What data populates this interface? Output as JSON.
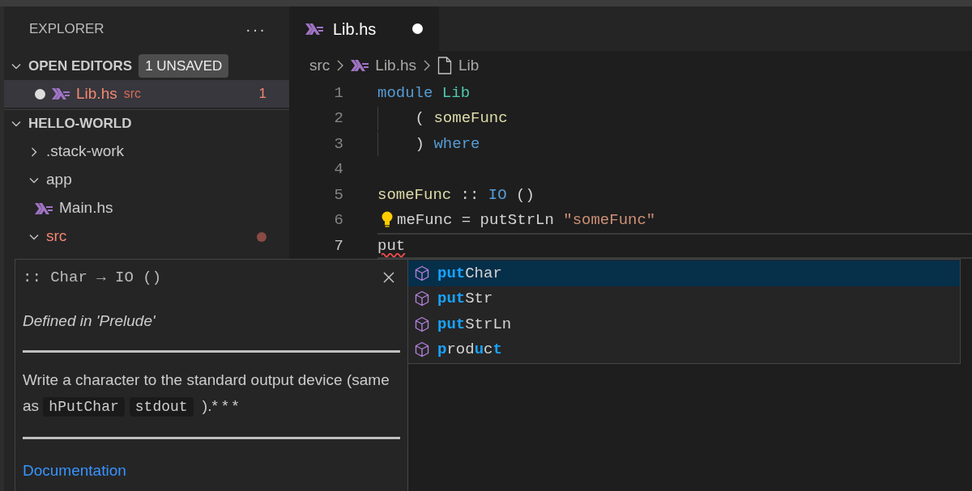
{
  "sidebar": {
    "title": "EXPLORER",
    "more": "···",
    "open_editors": {
      "label": "OPEN EDITORS",
      "expanded": true,
      "badge": "1 UNSAVED",
      "items": [
        {
          "name": "Lib.hs",
          "folder": "src",
          "problems": "1",
          "unsaved": true,
          "selected": true
        }
      ]
    },
    "project": {
      "label": "HELLO-WORLD",
      "expanded": true,
      "children": [
        {
          "name": ".stack-work",
          "kind": "folder",
          "expanded": false,
          "error": false
        },
        {
          "name": "app",
          "kind": "folder",
          "expanded": true,
          "error": false,
          "children": [
            {
              "name": "Main.hs",
              "kind": "haskell",
              "error": false
            }
          ]
        },
        {
          "name": "src",
          "kind": "folder",
          "expanded": true,
          "error": true
        }
      ]
    }
  },
  "tabs": [
    {
      "label": "Lib.hs",
      "selected": true,
      "unsaved": true
    }
  ],
  "breadcrumb": [
    "src",
    "Lib.hs",
    "Lib"
  ],
  "editor": {
    "lines": [
      {
        "number": "1",
        "current": false,
        "guide": false,
        "tokens": [
          {
            "text": "module",
            "kind": "keyword"
          },
          {
            "text": " Lib",
            "kind": "module"
          }
        ]
      },
      {
        "number": "2",
        "current": false,
        "guide": true,
        "tokens": [
          {
            "text": "    ( ",
            "kind": "plain"
          },
          {
            "text": "someFunc",
            "kind": "function"
          }
        ]
      },
      {
        "number": "3",
        "current": false,
        "guide": true,
        "tokens": [
          {
            "text": "    ) ",
            "kind": "plain"
          },
          {
            "text": "where",
            "kind": "keyword"
          }
        ]
      },
      {
        "number": "4",
        "current": false,
        "guide": false
      },
      {
        "number": "5",
        "current": false,
        "guide": false,
        "tokens": [
          {
            "text": "someFunc",
            "kind": "function"
          },
          {
            "text": " :: ",
            "kind": "plain"
          },
          {
            "text": "IO",
            "kind": "keyword"
          },
          {
            "text": " ()",
            "kind": "plain"
          }
        ]
      },
      {
        "number": "6",
        "current": false,
        "guide": false,
        "lightbulb": true,
        "tokens": [
          {
            "text": "meFunc = putStrLn ",
            "kind": "plain"
          },
          {
            "text": "\"someFunc\"",
            "kind": "string"
          }
        ]
      },
      {
        "number": "7",
        "current": true,
        "guide": false,
        "tokens": [
          {
            "text": "put",
            "kind": "error"
          }
        ]
      }
    ]
  },
  "hover": {
    "signature": ":: Char → IO ()",
    "defined": "Defined in 'Prelude'",
    "description": [
      {
        "text": "Write a character to the standard output device (same as ",
        "kind": "text"
      },
      {
        "text": "hPutChar",
        "kind": "code"
      },
      {
        "text": "stdout",
        "kind": "code"
      },
      {
        "text": " ).* * *",
        "kind": "text"
      }
    ],
    "link": "Documentation"
  },
  "suggestions": [
    {
      "selected": true,
      "segments": [
        {
          "text": "put",
          "matched": true
        },
        {
          "text": "Char",
          "matched": false
        }
      ]
    },
    {
      "selected": false,
      "segments": [
        {
          "text": "put",
          "matched": true
        },
        {
          "text": "Str",
          "matched": false
        }
      ]
    },
    {
      "selected": false,
      "segments": [
        {
          "text": "put",
          "matched": true
        },
        {
          "text": "StrLn",
          "matched": false
        }
      ]
    },
    {
      "selected": false,
      "segments": [
        {
          "text": "p",
          "matched": true
        },
        {
          "text": "rod",
          "matched": false
        },
        {
          "text": "u",
          "matched": true
        },
        {
          "text": "c",
          "matched": false
        },
        {
          "text": "t",
          "matched": true
        }
      ]
    }
  ]
}
